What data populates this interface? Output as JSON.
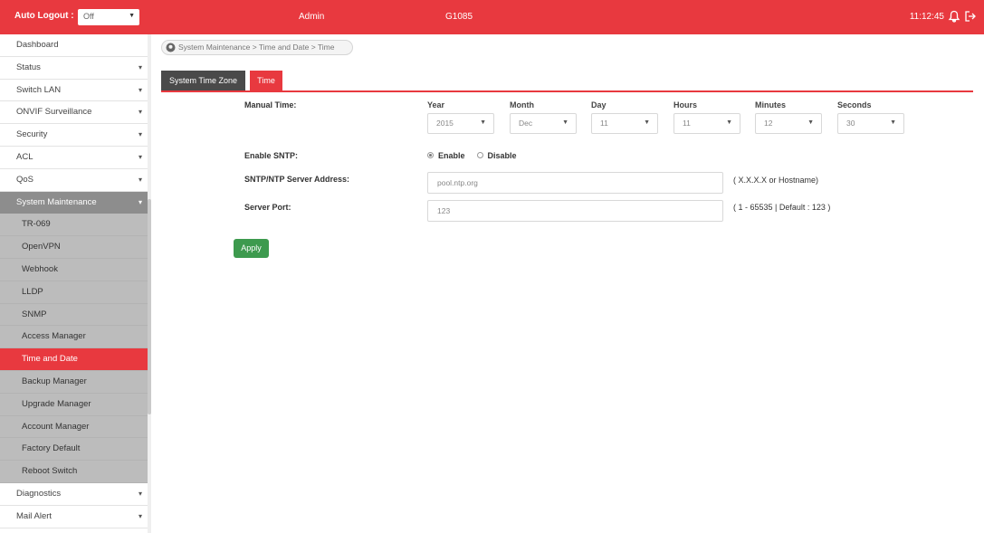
{
  "topbar": {
    "auto_logout_label": "Auto Logout :",
    "auto_logout_value": "Off",
    "user": "Admin",
    "model": "G1085",
    "time": "11:12:45"
  },
  "breadcrumb": "System Maintenance > Time and Date > Time",
  "sidebar": {
    "items": [
      {
        "label": "Dashboard"
      },
      {
        "label": "Status"
      },
      {
        "label": "Switch LAN"
      },
      {
        "label": "ONVIF Surveillance"
      },
      {
        "label": "Security"
      },
      {
        "label": "ACL"
      },
      {
        "label": "QoS"
      },
      {
        "label": "System Maintenance"
      },
      {
        "label": "Diagnostics"
      },
      {
        "label": "Mail Alert"
      }
    ],
    "sub_items": [
      {
        "label": "TR-069"
      },
      {
        "label": "OpenVPN"
      },
      {
        "label": "Webhook"
      },
      {
        "label": "LLDP"
      },
      {
        "label": "SNMP"
      },
      {
        "label": "Access Manager"
      },
      {
        "label": "Time and Date"
      },
      {
        "label": "Backup Manager"
      },
      {
        "label": "Upgrade Manager"
      },
      {
        "label": "Account Manager"
      },
      {
        "label": "Factory Default"
      },
      {
        "label": "Reboot Switch"
      }
    ]
  },
  "tabs": [
    {
      "label": "System Time Zone"
    },
    {
      "label": "Time"
    }
  ],
  "form": {
    "manual_time_label": "Manual Time:",
    "columns": [
      "Year",
      "Month",
      "Day",
      "Hours",
      "Minutes",
      "Seconds"
    ],
    "values": [
      "2015",
      "Dec",
      "11",
      "11",
      "12",
      "30"
    ],
    "enable_sntp_label": "Enable SNTP:",
    "enable_label": "Enable",
    "disable_label": "Disable",
    "sntp_enabled": true,
    "server_label": "SNTP/NTP Server Address:",
    "server_value": "pool.ntp.org",
    "server_hint": "( X.X.X.X or Hostname)",
    "port_label": "Server Port:",
    "port_value": "123",
    "port_hint": "( 1 - 65535 | Default : 123 )",
    "apply_label": "Apply"
  },
  "colors": {
    "accent": "#e8393f",
    "apply": "#3d9a4e",
    "sidebar_group": "#8d8d8d",
    "sidebar_sub": "#bcbcbc"
  }
}
